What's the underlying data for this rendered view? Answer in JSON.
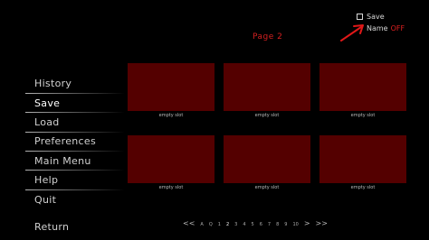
{
  "header": {
    "save_label": "Save",
    "name_label": "Name",
    "name_value": "OFF",
    "page_title": "Page 2"
  },
  "menu": {
    "items": [
      {
        "label": "History"
      },
      {
        "label": "Save",
        "active": true
      },
      {
        "label": "Load"
      },
      {
        "label": "Preferences"
      },
      {
        "label": "Main Menu"
      },
      {
        "label": "Help"
      },
      {
        "label": "Quit"
      }
    ],
    "return_label": "Return"
  },
  "slots": [
    {
      "caption": "empty slot"
    },
    {
      "caption": "empty slot"
    },
    {
      "caption": "empty slot"
    },
    {
      "caption": "empty slot"
    },
    {
      "caption": "empty slot"
    },
    {
      "caption": "empty slot"
    }
  ],
  "pager": {
    "prev": "<<",
    "pages": [
      "A",
      "Q",
      "1",
      "2",
      "3",
      "4",
      "5",
      "6",
      "7",
      "8",
      "9",
      "10"
    ],
    "current": "2",
    "next": ">",
    "last": ">>"
  },
  "colors": {
    "slot_fill": "#540000",
    "accent_red": "#d42020",
    "background": "#000000"
  },
  "icons": {
    "arrow": "red-arrow-icon",
    "checkbox": "checkbox-icon"
  }
}
